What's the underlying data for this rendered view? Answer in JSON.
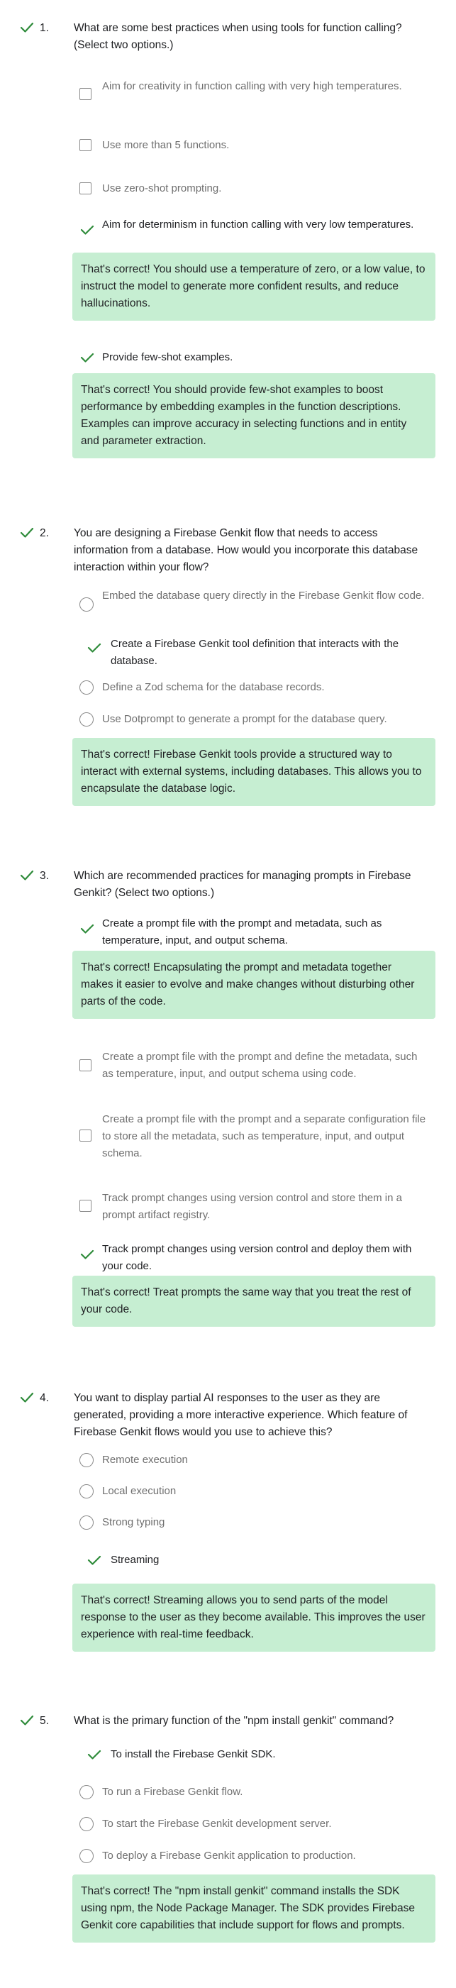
{
  "colors": {
    "correct_check": "#2e8b3a",
    "feedback_bg": "#c6eed2",
    "unselected_text": "#6f6f6f"
  },
  "questions": [
    {
      "number": "1.",
      "text": "What are some best practices when using tools for function calling? (Select two options.)",
      "options": [
        {
          "label": "Aim for creativity in function calling with very high temperatures.",
          "state": "unchecked"
        },
        {
          "label": "Use more than 5 functions.",
          "state": "unchecked"
        },
        {
          "label": "Use zero-shot prompting.",
          "state": "unchecked"
        },
        {
          "label": "Aim for determinism in function calling with very low temperatures.",
          "state": "correct"
        },
        {
          "label": "Provide few-shot examples.",
          "state": "correct"
        }
      ],
      "feedback": [
        "That's correct! You should use a temperature of zero, or a low value, to instruct the model to generate more confident results, and reduce hallucinations.",
        "That's correct! You should provide few-shot examples to boost performance by embedding examples in the function descriptions. Examples can improve accuracy in selecting functions and in entity and parameter extraction."
      ]
    },
    {
      "number": "2.",
      "text": "You are designing a Firebase Genkit flow that needs to access information from a database. How would you incorporate this database interaction within your flow?",
      "options": [
        {
          "label": "Embed the database query directly in the Firebase Genkit flow code.",
          "state": "radio"
        },
        {
          "label": "Create a Firebase Genkit tool definition that interacts with the database.",
          "state": "correct"
        },
        {
          "label": "Define a Zod schema for the database records.",
          "state": "radio"
        },
        {
          "label": "Use Dotprompt to generate a prompt for the database query.",
          "state": "radio"
        }
      ],
      "feedback": [
        "That's correct! Firebase Genkit tools provide a structured way to interact with external systems, including databases. This allows you to encapsulate the database logic."
      ]
    },
    {
      "number": "3.",
      "text": "Which are recommended practices for managing prompts in Firebase Genkit? (Select two options.)",
      "options": [
        {
          "label": "Create a prompt file with the prompt and metadata, such as temperature, input, and output schema.",
          "state": "correct"
        },
        {
          "label": "Create a prompt file with the prompt and define the metadata, such as temperature, input, and output schema using code.",
          "state": "unchecked"
        },
        {
          "label": "Create a prompt file with the prompt and a separate configuration file to store all the metadata, such as temperature, input, and output schema.",
          "state": "unchecked"
        },
        {
          "label": "Track prompt changes using version control and store them in a prompt artifact registry.",
          "state": "unchecked"
        },
        {
          "label": "Track prompt changes using version control and deploy them with your code.",
          "state": "correct"
        }
      ],
      "feedback": [
        "That's correct! Encapsulating the prompt and metadata together makes it easier to evolve and make changes without disturbing other parts of the code.",
        "That's correct! Treat prompts the same way that you treat the rest of your code."
      ]
    },
    {
      "number": "4.",
      "text": "You want to display partial AI responses to the user as they are generated, providing a more interactive experience. Which feature of Firebase Genkit flows would you use to achieve this?",
      "options": [
        {
          "label": "Remote execution",
          "state": "radio"
        },
        {
          "label": "Local execution",
          "state": "radio"
        },
        {
          "label": "Strong typing",
          "state": "radio"
        },
        {
          "label": "Streaming",
          "state": "correct"
        }
      ],
      "feedback": [
        "That's correct! Streaming allows you to send parts of the model response to the user as they become available. This improves the user experience with real-time feedback."
      ]
    },
    {
      "number": "5.",
      "text": "What is the primary function of the \"npm install genkit\" command?",
      "options": [
        {
          "label": "To install the Firebase Genkit SDK.",
          "state": "correct"
        },
        {
          "label": "To run a Firebase Genkit flow.",
          "state": "radio"
        },
        {
          "label": "To start the Firebase Genkit development server.",
          "state": "radio"
        },
        {
          "label": "To deploy a Firebase Genkit application to production.",
          "state": "radio"
        }
      ],
      "feedback": [
        "That's correct! The \"npm install genkit\" command installs the SDK using npm, the Node Package Manager. The SDK provides Firebase Genkit core capabilities that include support for flows and prompts."
      ]
    }
  ]
}
